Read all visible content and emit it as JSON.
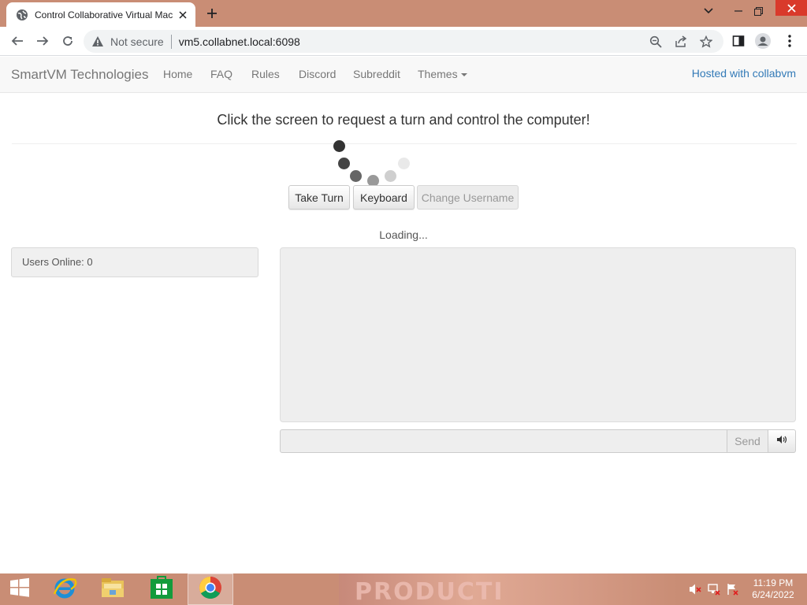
{
  "browser": {
    "tab_title": "Control Collaborative Virtual Mac",
    "security_label": "Not secure",
    "url": "vm5.collabnet.local:6098"
  },
  "navbar": {
    "brand": "SmartVM Technologies",
    "links": [
      "Home",
      "FAQ",
      "Rules",
      "Discord",
      "Subreddit",
      "Themes"
    ],
    "hosted": "Hosted with collabvm"
  },
  "main": {
    "headline": "Click the screen to request a turn and control the computer!",
    "buttons": {
      "take_turn": "Take Turn",
      "keyboard": "Keyboard",
      "change_username": "Change Username"
    },
    "loading": "Loading...",
    "users_online": "Users Online: 0",
    "send_label": "Send",
    "chat_input_value": ""
  },
  "taskbar": {
    "wallpaper_text": "PRODUCTI",
    "time": "11:19 PM",
    "date": "6/24/2022"
  },
  "colors": {
    "chrome_frame": "#c98d75",
    "link_blue": "#337ab7",
    "nav_text": "#777777"
  },
  "icons": [
    "globe-icon",
    "close-icon",
    "plus-icon",
    "chevron-down-icon",
    "minimize-icon",
    "restore-icon",
    "back-icon",
    "forward-icon",
    "reload-icon",
    "warning-icon",
    "zoom-icon",
    "share-icon",
    "star-icon",
    "sidepanel-icon",
    "profile-icon",
    "kebab-menu-icon",
    "volume-icon",
    "start-icon",
    "ie-icon",
    "explorer-icon",
    "store-icon",
    "chrome-icon",
    "mute-icon",
    "network-icon",
    "flag-icon"
  ]
}
